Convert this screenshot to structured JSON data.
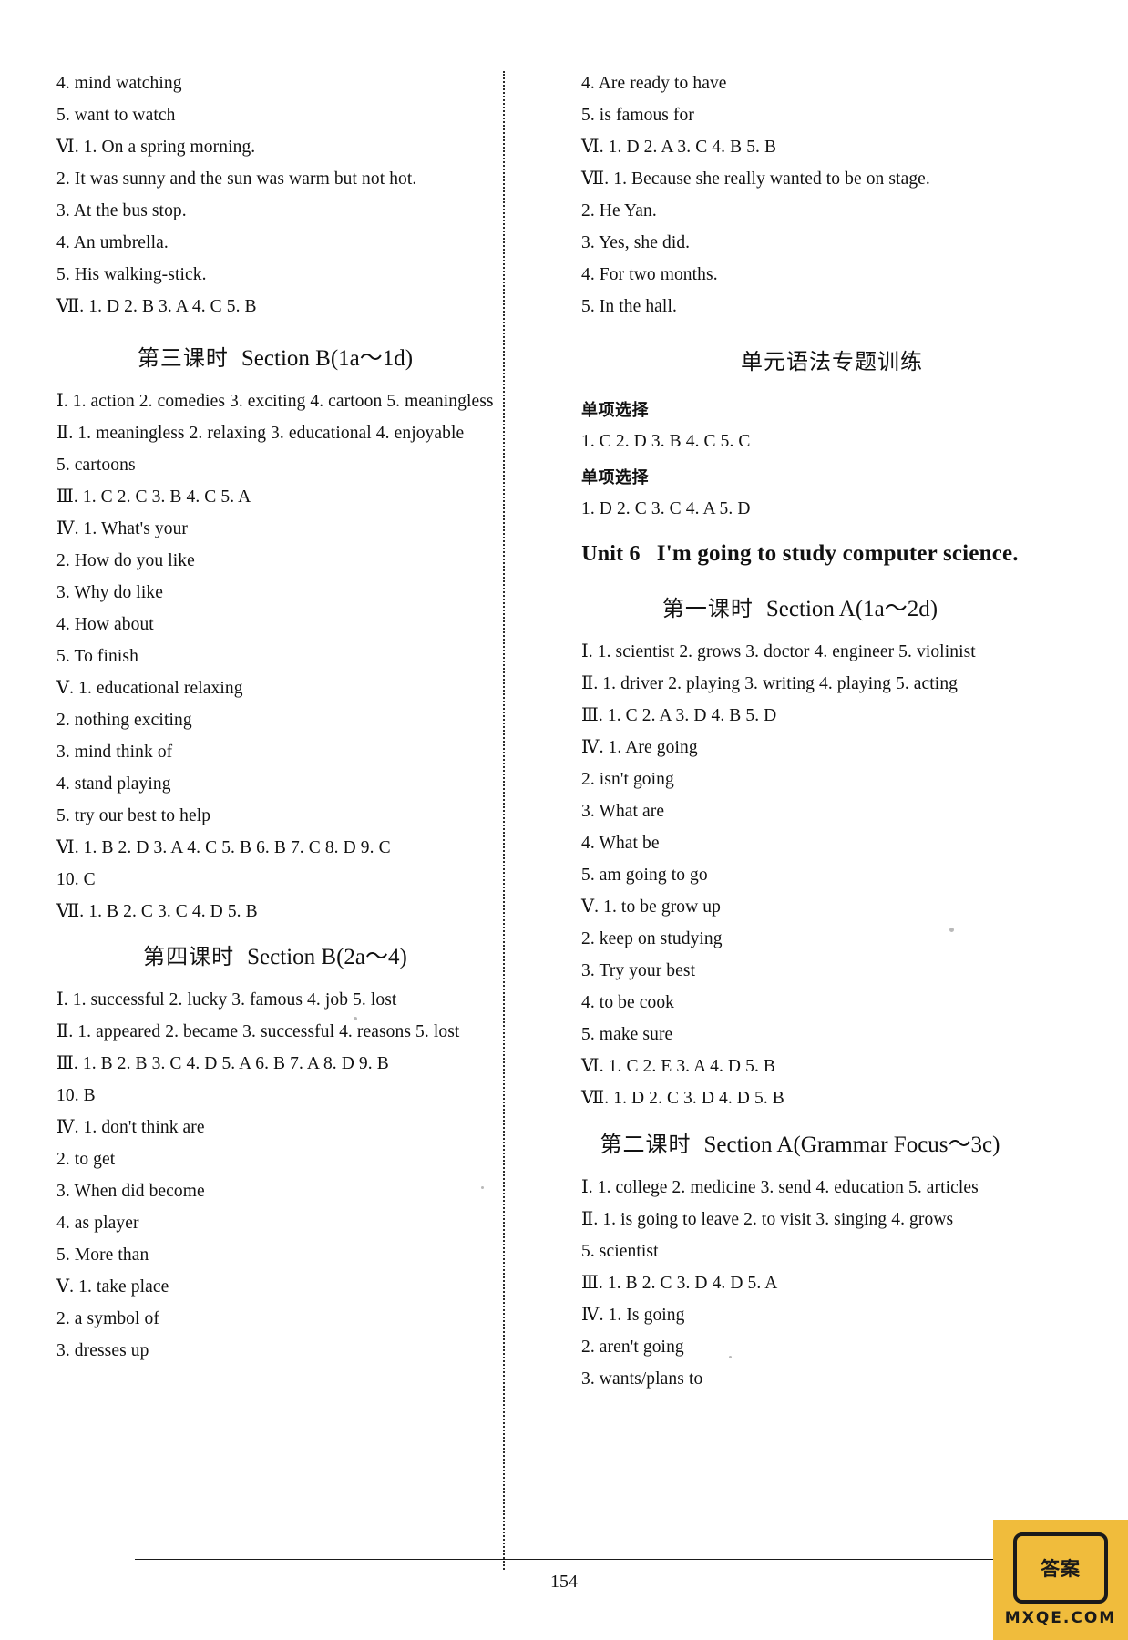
{
  "page": {
    "number": "154"
  },
  "watermark": {
    "badge": "答案",
    "label": "MXQE.COM"
  },
  "left_column": {
    "lines_top": [
      "4. mind    watching",
      "5. want    to    watch",
      "Ⅵ. 1. On a spring morning.",
      "2. It was sunny and the sun was warm but not hot.",
      "3. At the bus stop.",
      "4. An umbrella.",
      "5. His walking-stick.",
      "Ⅶ. 1. D   2. B   3. A   4. C   5. B"
    ],
    "lesson3": {
      "cn": "第三课时",
      "en": "Section B(1a～1d)",
      "lines": [
        "Ⅰ. 1. action   2. comedies   3. exciting   4. cartoon   5. meaningless",
        "Ⅱ. 1. meaningless   2. relaxing   3. educational   4. enjoyable",
        "5. cartoons",
        "Ⅲ. 1. C   2. C   3. B   4. C   5. A",
        "Ⅳ. 1. What's   your",
        "2. How   do   you   like",
        "3. Why   do   like",
        "4. How   about",
        "5. To   finish",
        "Ⅴ. 1. educational   relaxing",
        "2. nothing   exciting",
        "3. mind   think   of",
        "4. stand   playing",
        "5. try   our   best   to   help",
        "Ⅵ. 1. B   2. D   3. A   4. C   5. B   6. B   7. C   8. D   9. C",
        "10. C",
        "Ⅶ. 1. B   2. C   3. C   4. D   5. B"
      ]
    },
    "lesson4": {
      "cn": "第四课时",
      "en": "Section B(2a～4)",
      "lines": [
        "Ⅰ. 1. successful   2. lucky   3. famous   4. job   5. lost",
        "Ⅱ. 1. appeared   2. became   3. successful   4. reasons   5. lost",
        "Ⅲ. 1. B   2. B   3. C   4. D   5. A   6. B   7. A   8. D   9. B",
        "10. B",
        "Ⅳ. 1. don't   think   are",
        "2. to   get",
        "3. When   did   become",
        "4. as   player",
        "5. More   than",
        "Ⅴ. 1. take   place",
        "2. a   symbol   of",
        "3. dresses   up"
      ]
    }
  },
  "right_column": {
    "lines_top": [
      "4. Are   ready   to   have",
      "5. is   famous   for",
      "Ⅵ. 1. D   2. A   3. C   4. B   5. B",
      "Ⅶ. 1. Because she really wanted to be on stage.",
      "2. He Yan.",
      "3. Yes, she did.",
      "4. For two months.",
      "5. In the hall."
    ],
    "grammar_section": {
      "title": "单元语法专题训练",
      "blocks": [
        {
          "heading": "单项选择",
          "answers": "1. C   2. D   3. B   4. C   5. C"
        },
        {
          "heading": "单项选择",
          "answers": "1. D   2. C   3. C   4. A   5. D"
        }
      ]
    },
    "unit": {
      "label": "Unit 6",
      "title": "I'm going to study computer science."
    },
    "lesson1": {
      "cn": "第一课时",
      "en": "Section A(1a～2d)",
      "lines": [
        "Ⅰ. 1. scientist   2. grows   3. doctor   4. engineer   5. violinist",
        "Ⅱ. 1. driver   2. playing   3. writing   4. playing   5. acting",
        "Ⅲ. 1. C   2. A   3. D   4. B   5. D",
        "Ⅳ. 1. Are   going",
        "2. isn't   going",
        "3. What   are",
        "4. What   be",
        "5. am   going   to   go",
        "Ⅴ. 1. to   be   grow   up",
        "2. keep   on   studying",
        "3. Try   your   best",
        "4. to   be   cook",
        "5. make   sure",
        "Ⅵ. 1. C   2. E   3. A   4. D   5. B",
        "Ⅶ. 1. D   2. C   3. D   4. D   5. B"
      ]
    },
    "lesson2": {
      "cn": "第二课时",
      "en": "Section A(Grammar Focus～3c)",
      "lines": [
        "Ⅰ. 1. college   2. medicine   3. send   4. education   5. articles",
        "Ⅱ. 1. is going to leave   2. to visit   3. singing   4. grows",
        "5. scientist",
        "Ⅲ. 1. B   2. C   3. D   4. D   5. A",
        "Ⅳ. 1. Is   going",
        "2. aren't   going",
        "3. wants/plans   to"
      ]
    }
  }
}
